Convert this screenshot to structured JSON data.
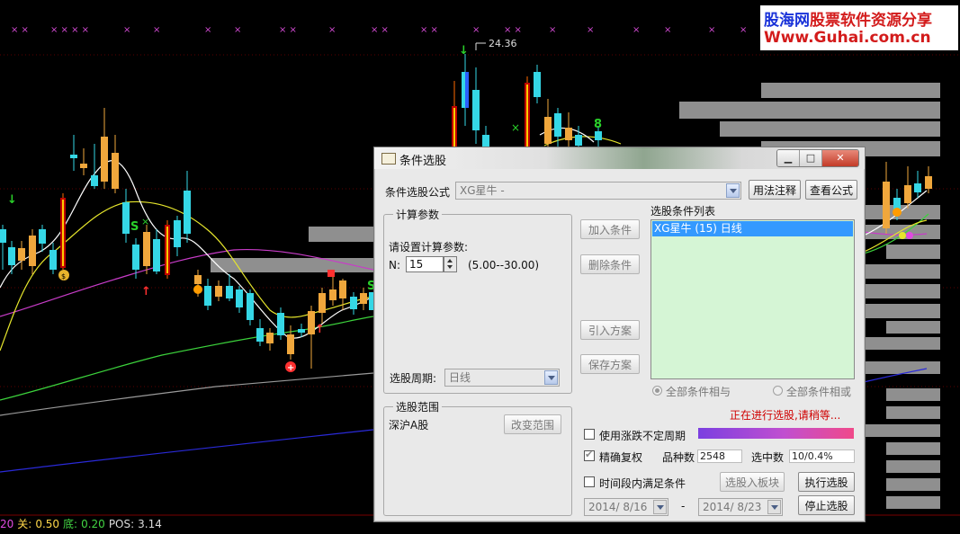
{
  "app": {
    "logo_line1_part1": "股海网",
    "logo_line1_part2": "股票软件资源分享",
    "logo_line2": "Www.Guhai.com.cn"
  },
  "chart_info": {
    "peak_price_label": "24.36"
  },
  "status_bar": {
    "prefix": "20",
    "k1": "关:",
    "v1": "0.50",
    "k2": "底:",
    "v2": "0.20",
    "k3": "POS:",
    "v3": "3.14"
  },
  "dialog": {
    "title": "条件选股",
    "formula_label": "条件选股公式",
    "formula_value": "XG星牛  -",
    "usage_button": "用法注释",
    "view_formula_button": "查看公式",
    "calc_group_title": "计算参数",
    "param_prompt": "请设置计算参数:",
    "param_name": "N:",
    "param_value": "15",
    "param_range": "(5.00--30.00)",
    "period_label": "选股周期:",
    "period_value": "日线",
    "add_condition": "加入条件",
    "delete_condition": "删除条件",
    "import_plan": "引入方案",
    "save_plan": "保存方案",
    "condition_list_title": "选股条件列表",
    "condition_items": [
      "XG星牛 (15) 日线"
    ],
    "radio_and": "全部条件相与",
    "radio_or": "全部条件相或",
    "scope_group_title": "选股范围",
    "scope_value": "深沪A股",
    "change_scope": "改变范围",
    "progress_text": "正在进行选股,请稍等...",
    "irregular_period": "使用涨跌不定周期",
    "exact_rights": "精确复权",
    "count_label": "品种数",
    "count_value": "2548",
    "selected_label": "选中数",
    "selected_value": "10/0.4%",
    "time_range_label": "时间段内满足条件",
    "to_block_button": "选股入板块",
    "execute_button": "执行选股",
    "date_from": "2014/ 8/16",
    "date_sep": "-",
    "date_to": "2014/ 8/23",
    "stop_button": "停止选股"
  },
  "colors": {
    "up_candle": "#f0a73c",
    "down_candle": "#35d7e6",
    "ma_white": "#ffffff",
    "ma_yellow": "#e6e62c",
    "ma_magenta": "#c83cc8",
    "ma_green": "#3cd23c",
    "ma_gray": "#9a9a9a",
    "ma_blue": "#2a2ad8",
    "dialog_bg": "#e9e9e9",
    "list_bg": "#d5f5d5",
    "progress_red": "#d00000"
  }
}
